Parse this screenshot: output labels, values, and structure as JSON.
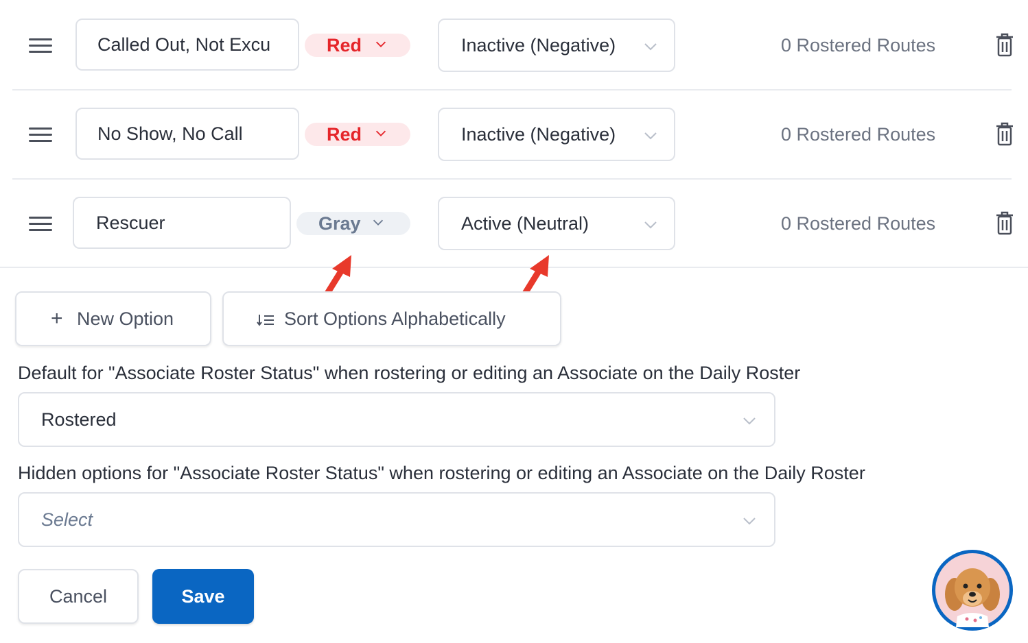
{
  "rows": [
    {
      "name": "Called Out, Not Excu",
      "color": "Red",
      "status": "Inactive (Negative)",
      "routes": "0 Rostered Routes"
    },
    {
      "name": "No Show, No Call",
      "color": "Red",
      "status": "Inactive (Negative)",
      "routes": "0 Rostered Routes"
    },
    {
      "name": "Rescuer",
      "color": "Gray",
      "status": "Active (Neutral)",
      "routes": "0 Rostered Routes"
    }
  ],
  "actions": {
    "new_option": "New Option",
    "sort_options": "Sort Options Alphabetically"
  },
  "default_field": {
    "label": "Default for \"Associate Roster Status\" when rostering or editing an Associate on the Daily Roster",
    "value": "Rostered"
  },
  "hidden_field": {
    "label": "Hidden options for \"Associate Roster Status\" when rostering or editing an Associate on the Daily Roster",
    "placeholder": "Select"
  },
  "footer": {
    "cancel": "Cancel",
    "save": "Save"
  },
  "colors": {
    "red": "#e5252a",
    "gray": "#6b7a91",
    "primary": "#0a66c2",
    "annotation_arrow": "#e8392b"
  }
}
